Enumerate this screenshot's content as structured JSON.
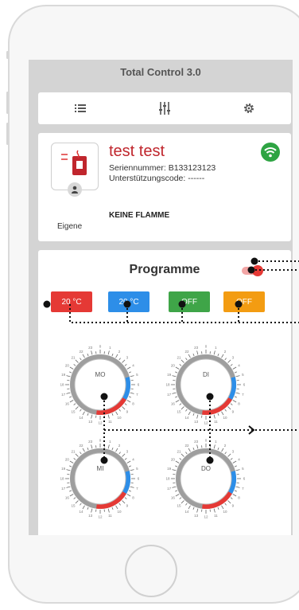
{
  "app": {
    "title": "Total Control 3.0"
  },
  "toolbar": {
    "icons": [
      "list-icon",
      "sliders-icon",
      "gear-icon"
    ]
  },
  "device": {
    "name": "test test",
    "serial": "Seriennummer: B133123123",
    "support": "Unterstützungscode: ------",
    "flame_status": "KEINE FLAMME",
    "owner": "Eigene",
    "wifi_color": "#2ea443"
  },
  "programs": {
    "title": "Programme",
    "toggle_on": true,
    "chips": [
      {
        "label": "20 °C",
        "color": "#e53935"
      },
      {
        "label": "20 °C",
        "color": "#2d8ee8"
      },
      {
        "label": "OFF",
        "color": "#3fa548"
      },
      {
        "label": "OFF",
        "color": "#f39c12"
      }
    ],
    "dials": [
      {
        "day": "MO"
      },
      {
        "day": "DI"
      },
      {
        "day": "MI"
      },
      {
        "day": "DO"
      }
    ]
  },
  "colors": {
    "accent": "#c0262d",
    "red": "#e53935",
    "blue": "#2d8ee8"
  }
}
